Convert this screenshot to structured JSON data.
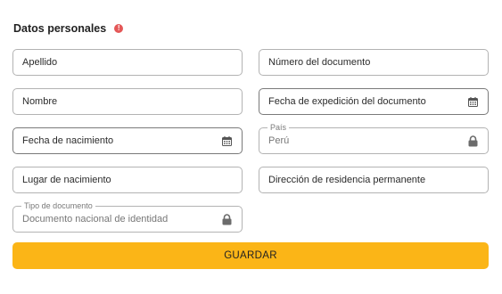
{
  "section": {
    "title": "Datos personales",
    "alert_symbol": "!"
  },
  "fields": {
    "apellido": {
      "label": "Apellido"
    },
    "numero_documento": {
      "label": "Número del documento"
    },
    "nombre": {
      "label": "Nombre"
    },
    "fecha_expedicion": {
      "label": "Fecha de expedición del documento",
      "icon": "calendar-icon"
    },
    "fecha_nacimiento": {
      "label": "Fecha de nacimiento",
      "icon": "calendar-icon"
    },
    "pais": {
      "legend": "País",
      "value": "Perú",
      "icon": "lock-icon"
    },
    "lugar_nacimiento": {
      "label": "Lugar de nacimiento"
    },
    "direccion": {
      "label": "Dirección de residencia permanente"
    },
    "tipo_documento": {
      "legend": "Tipo de documento",
      "value": "Documento nacional de identidad",
      "icon": "lock-icon"
    }
  },
  "actions": {
    "save_label": "GUARDAR"
  },
  "colors": {
    "primary_button": "#fbb517",
    "alert": "#e45757",
    "border": "#b3b3b3"
  }
}
